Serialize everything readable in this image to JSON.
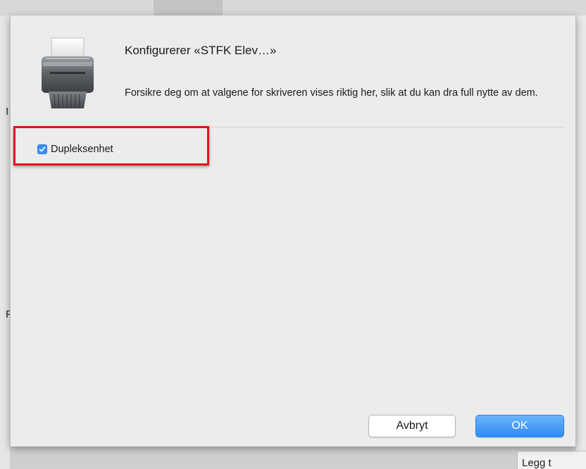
{
  "dialog": {
    "title": "Konfigurerer «STFK Elev…»",
    "description": "Forsikre deg om at valgene for skriveren vises riktig her, slik at du kan dra full nytte av dem.",
    "options": [
      {
        "label": "Dupleksenhet",
        "checked": true
      }
    ],
    "buttons": {
      "cancel_label": "Avbryt",
      "ok_label": "OK"
    },
    "icon": "printer-icon"
  },
  "background": {
    "left_fragment_1": "I",
    "left_fragment_2": "F",
    "bottom_right_text": "Legg t"
  },
  "colors": {
    "accent": "#2e8bf5",
    "highlight": "#e0161b",
    "checkbox": "#3a8ef6"
  }
}
